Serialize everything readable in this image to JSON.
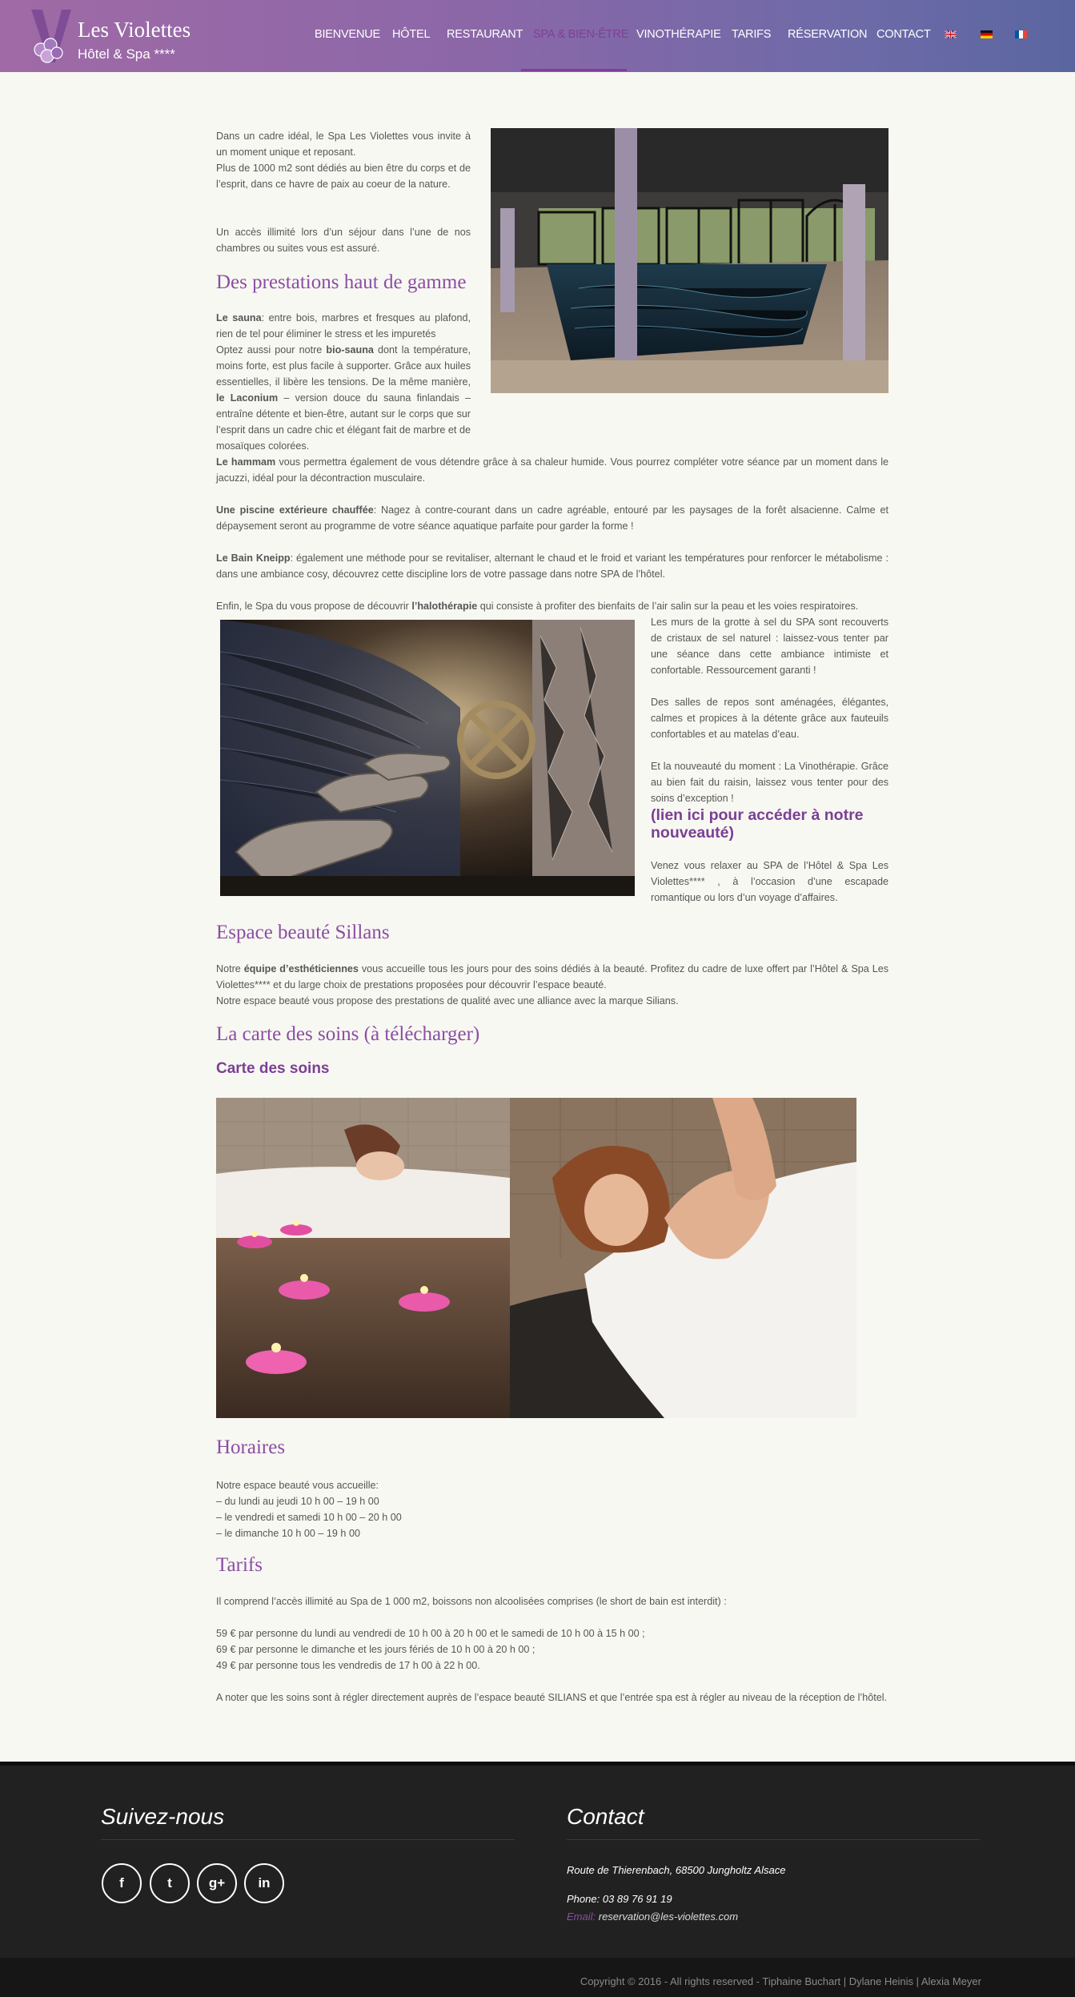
{
  "header": {
    "logo_title": "Les Violettes",
    "logo_subtitle": "Hôtel & Spa ****",
    "nav": [
      {
        "label": "BIENVENUE"
      },
      {
        "label": "HÔTEL"
      },
      {
        "label": "RESTAURANT"
      },
      {
        "label": "SPA & BIEN-ÊTRE",
        "active": true
      },
      {
        "label": "VINOTHÉRAPIE"
      },
      {
        "label": "TARIFS"
      },
      {
        "label": "RÉSERVATION"
      },
      {
        "label": "CONTACT"
      }
    ],
    "flags": [
      "english-flag-icon",
      "german-flag-icon",
      "french-flag-icon"
    ],
    "colors": {
      "header_from": "#a06aa6",
      "header_to": "#5a66a0",
      "accent": "#7f3f98"
    }
  },
  "intro": {
    "p1a": "Dans un cadre idéal, le Spa Les Violettes vous invite à un moment unique et reposant.",
    "p1b": "Plus de 1000 m2 sont dédiés au bien être du corps et de l’esprit, dans ce havre de paix au coeur de la nature.",
    "p2": "Un accès illimité lors d’un séjour dans l’une de nos chambres ou suites vous est assuré."
  },
  "prestations": {
    "title": "Des prestations haut de gamme",
    "sauna_bold": "Le sauna",
    "sauna_text": ": entre bois, marbres et fresques au plafond, rien de tel pour éliminer le stress et les impuretés",
    "bio_pre": "Optez aussi pour notre ",
    "bio_bold": "bio-sauna",
    "bio_text": " dont la température, moins forte, est plus facile à supporter. Grâce aux huiles essentielles, il libère les tensions. De la même manière, ",
    "laconium_bold": "le Laconium",
    "laconium_text": " – version douce du sauna finlandais – entraîne détente et bien-être, autant sur le corps que sur l’esprit dans un cadre chic et élégant fait de marbre et de mosaïques colorées.",
    "hammam_bold": "Le hammam",
    "hammam_text": " vous permettra également de vous détendre grâce à sa chaleur humide. Vous pourrez compléter votre séance par un moment dans le jacuzzi, idéal pour la décontraction musculaire.",
    "piscine_bold": "Une piscine extérieure chauffée",
    "piscine_text": ": Nagez à contre-courant dans un cadre agréable, entouré par les paysages de la forêt alsacienne. Calme et dépaysement seront au programme de votre séance aquatique parfaite pour garder la forme !",
    "kneipp_bold": "Le Bain Kneipp",
    "kneipp_text": ": également une méthode pour se revitaliser, alternant le chaud et le froid et variant les températures pour renforcer le métabolisme : dans une ambiance cosy, découvrez cette discipline lors de votre passage dans notre SPA de l’hôtel.",
    "halo_pre": "Enfin, le Spa du vous propose de découvrir ",
    "halo_bold": "l’halothérapie",
    "halo_text": " qui consiste à profiter des bienfaits de l’air salin sur la peau et les voies respiratoires.",
    "grotte": "Les murs de la grotte à sel du SPA sont recouverts de cristaux de sel naturel : laissez-vous tenter par une séance dans cette ambiance intimiste et confortable. Ressourcement garanti !",
    "repos": "Des salles de repos sont aménagées, élégantes, calmes et propices à la détente grâce aux fauteuils confortables et au matelas d’eau.",
    "nouveaute": "Et la nouveauté du moment : La Vinothérapie. Grâce au bien fait du raisin, laissez vous tenter pour des soins d’exception !",
    "lien": "(lien ici pour accéder à notre nouveauté)",
    "venez": "Venez vous relaxer au SPA de l’Hôtel & Spa Les Violettes**** , à l’occasion d’une escapade romantique ou lors d’un voyage d’affaires."
  },
  "beaute": {
    "title": "Espace beauté Sillans",
    "pre": "Notre ",
    "bold": "équipe d’esthéticiennes",
    "text": " vous accueille tous les jours pour des soins dédiés à la beauté. Profitez du cadre de luxe offert par l’Hôtel & Spa Les Violettes**** et du large choix de prestations proposées pour découvrir l’espace beauté.",
    "line2": "Notre espace beauté vous propose des prestations de qualité avec une alliance avec la marque Silians."
  },
  "carte": {
    "title": "La carte des soins (à télécharger)",
    "link": "Carte des soins"
  },
  "horaires": {
    "title": "Horaires",
    "lines": [
      "Notre espace beauté vous accueille:",
      "– du lundi au jeudi 10 h 00 – 19 h 00",
      "– le vendredi et samedi 10 h 00 – 20 h 00",
      "– le dimanche 10 h 00 – 19 h 00"
    ]
  },
  "tarifs": {
    "title": "Tarifs",
    "intro": "Il comprend l’accès illimité au Spa de 1 000 m2, boissons non alcoolisées comprises (le short de bain est interdit) :",
    "prices": [
      "59 € par personne du lundi au vendredi de 10 h 00 à 20 h 00 et le samedi de 10 h 00 à 15 h 00 ;",
      "69 € par personne le dimanche et les jours fériés de 10 h 00 à 20 h 00 ;",
      "49 € par personne tous les vendredis de 17 h 00 à 22 h 00."
    ],
    "note": "A noter que les soins sont à régler directement auprès de l’espace beauté SILIANS et que l’entrée spa est à régler au niveau de la réception de l’hôtel."
  },
  "footer": {
    "follow_title": "Suivez-nous",
    "social": [
      {
        "icon": "facebook-icon",
        "glyph": "f"
      },
      {
        "icon": "twitter-icon",
        "glyph": "t"
      },
      {
        "icon": "google-plus-icon",
        "glyph": "g+"
      },
      {
        "icon": "linkedin-icon",
        "glyph": "in"
      }
    ],
    "contact_title": "Contact",
    "address": "Route de Thierenbach, 68500 Jungholtz Alsace",
    "phone": "Phone: 03 89 76 91 19",
    "email_label": "Email:",
    "email": "reservation@les-violettes.com",
    "copyright": "Copyright © 2016 - All rights reserved - Tiphaine Buchart | Dylane Heinis | Alexia Meyer"
  }
}
